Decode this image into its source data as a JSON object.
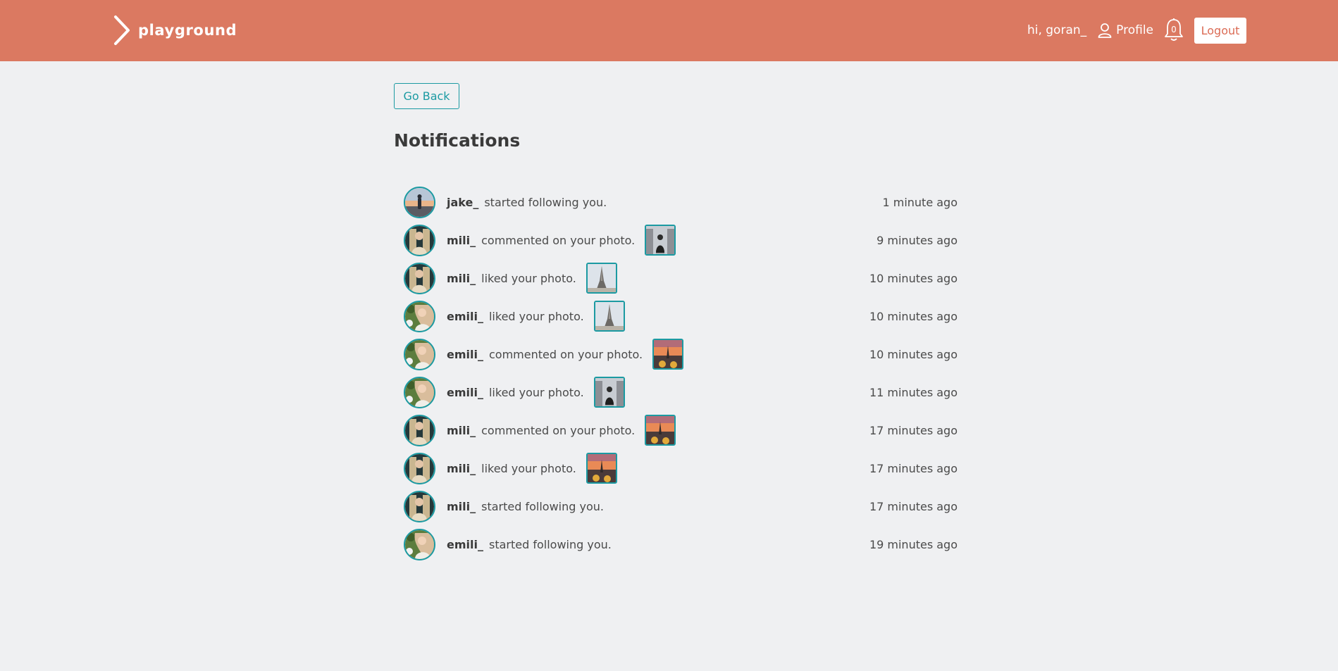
{
  "navbar": {
    "brand": "playground",
    "greeting": "hi, goran_",
    "profile_label": "Profile",
    "notification_count": "0",
    "logout_label": "Logout",
    "bg_color": "#db7961"
  },
  "page": {
    "go_back_label": "Go Back",
    "title": "Notifications",
    "accent_color": "#1b9aa2"
  },
  "notifications": [
    {
      "user": "jake_",
      "message": "started following you.",
      "time": "1 minute ago",
      "avatar": "jake-avatar",
      "thumb": null
    },
    {
      "user": "mili_",
      "message": "commented on your photo.",
      "time": "9 minutes ago",
      "avatar": "mili-avatar",
      "thumb": "street-photo"
    },
    {
      "user": "mili_",
      "message": "liked your photo.",
      "time": "10 minutes ago",
      "avatar": "mili-avatar",
      "thumb": "eiffel-photo"
    },
    {
      "user": "emili_",
      "message": "liked your photo.",
      "time": "10 minutes ago",
      "avatar": "emili-avatar",
      "thumb": "eiffel-photo"
    },
    {
      "user": "emili_",
      "message": "commented on your photo.",
      "time": "10 minutes ago",
      "avatar": "emili-avatar",
      "thumb": "sunset-photo"
    },
    {
      "user": "emili_",
      "message": "liked your photo.",
      "time": "11 minutes ago",
      "avatar": "emili-avatar",
      "thumb": "street-photo"
    },
    {
      "user": "mili_",
      "message": "commented on your photo.",
      "time": "17 minutes ago",
      "avatar": "mili-avatar",
      "thumb": "sunset-photo"
    },
    {
      "user": "mili_",
      "message": "liked your photo.",
      "time": "17 minutes ago",
      "avatar": "mili-avatar",
      "thumb": "sunset-photo"
    },
    {
      "user": "mili_",
      "message": "started following you.",
      "time": "17 minutes ago",
      "avatar": "mili-avatar",
      "thumb": null
    },
    {
      "user": "emili_",
      "message": "started following you.",
      "time": "19 minutes ago",
      "avatar": "emili-avatar",
      "thumb": null
    }
  ]
}
